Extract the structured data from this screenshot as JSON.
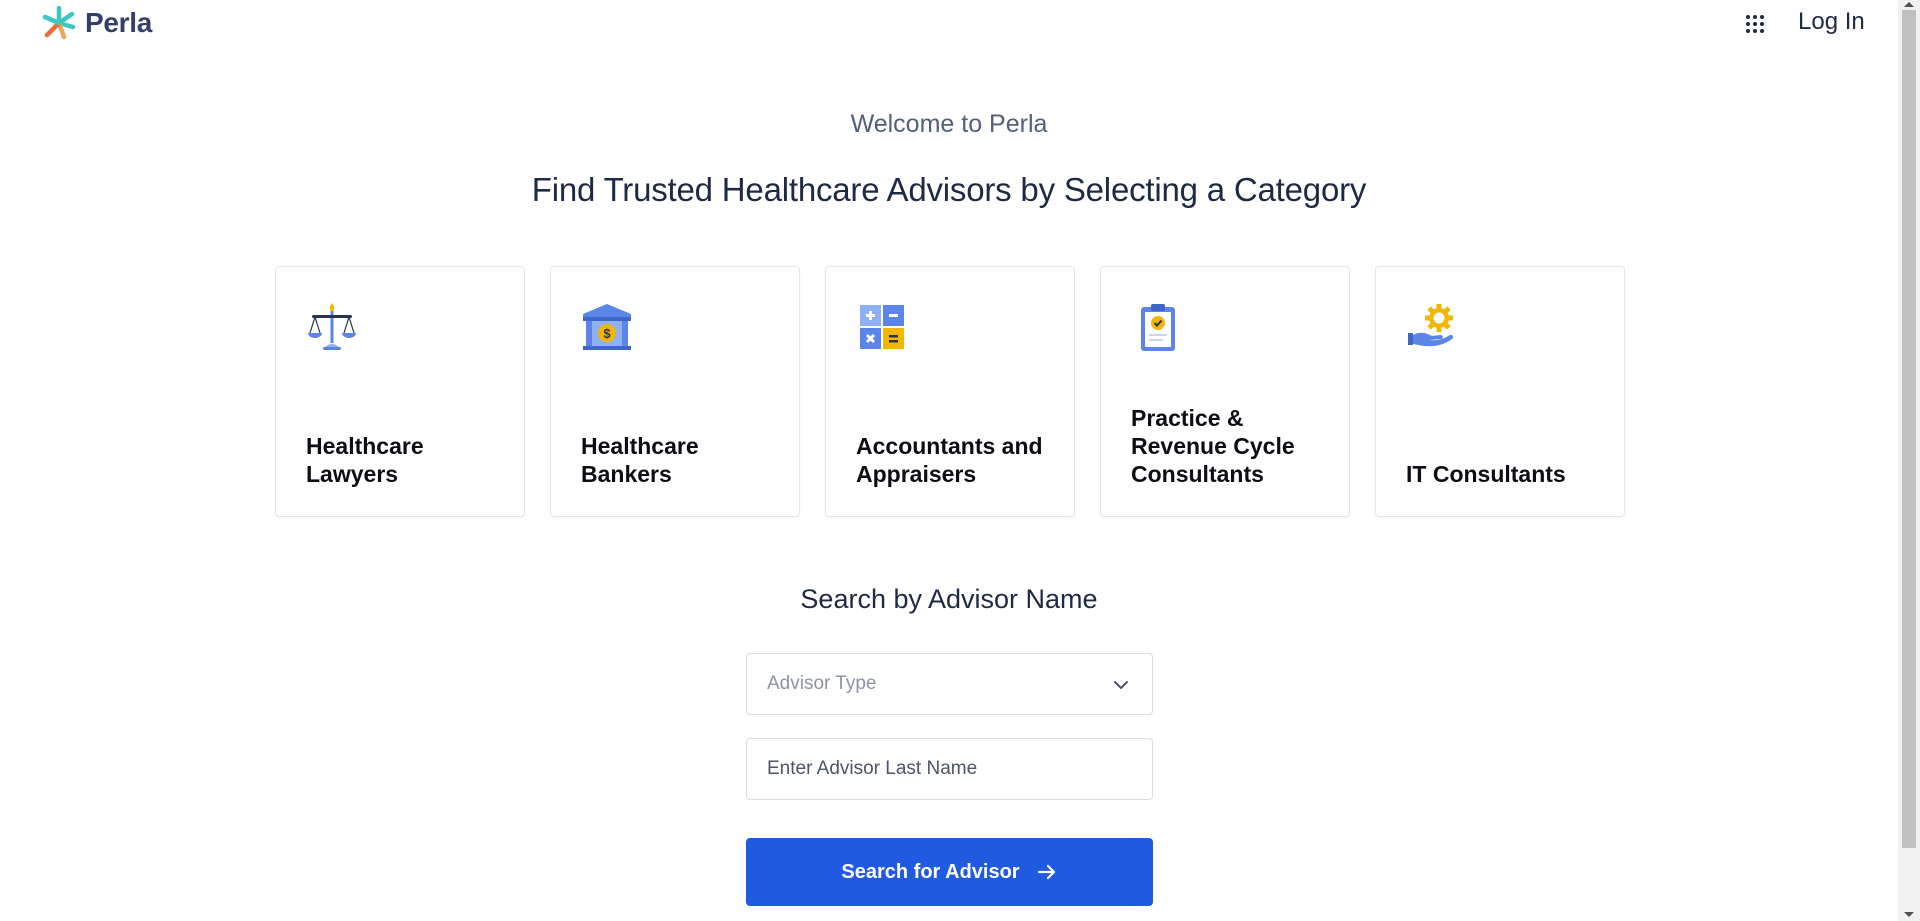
{
  "header": {
    "brand": "Perla",
    "apps_icon": "grid-icon",
    "login_label": "Log In"
  },
  "welcome": "Welcome to Perla",
  "main_title": "Find Trusted Healthcare Advisors by Selecting a Category",
  "categories": [
    {
      "label": "Healthcare\nLawyers",
      "icon": "scales-icon"
    },
    {
      "label": "Healthcare\nBankers",
      "icon": "bank-icon"
    },
    {
      "label": "Accountants and\nAppraisers",
      "icon": "calculator-icon"
    },
    {
      "label": "Practice &\nRevenue Cycle\nConsultants",
      "icon": "clipboard-check-icon"
    },
    {
      "label": "IT Consultants",
      "icon": "hand-gear-icon"
    }
  ],
  "search": {
    "title": "Search by Advisor Name",
    "advisor_type_placeholder": "Advisor Type",
    "last_name_placeholder": "Enter Advisor Last Name",
    "button_label": "Search for Advisor"
  },
  "colors": {
    "primary_button": "#1f5ae0",
    "heading": "#1e2a44",
    "icon_blue": "#5b86e8",
    "icon_yellow": "#f2b705"
  }
}
